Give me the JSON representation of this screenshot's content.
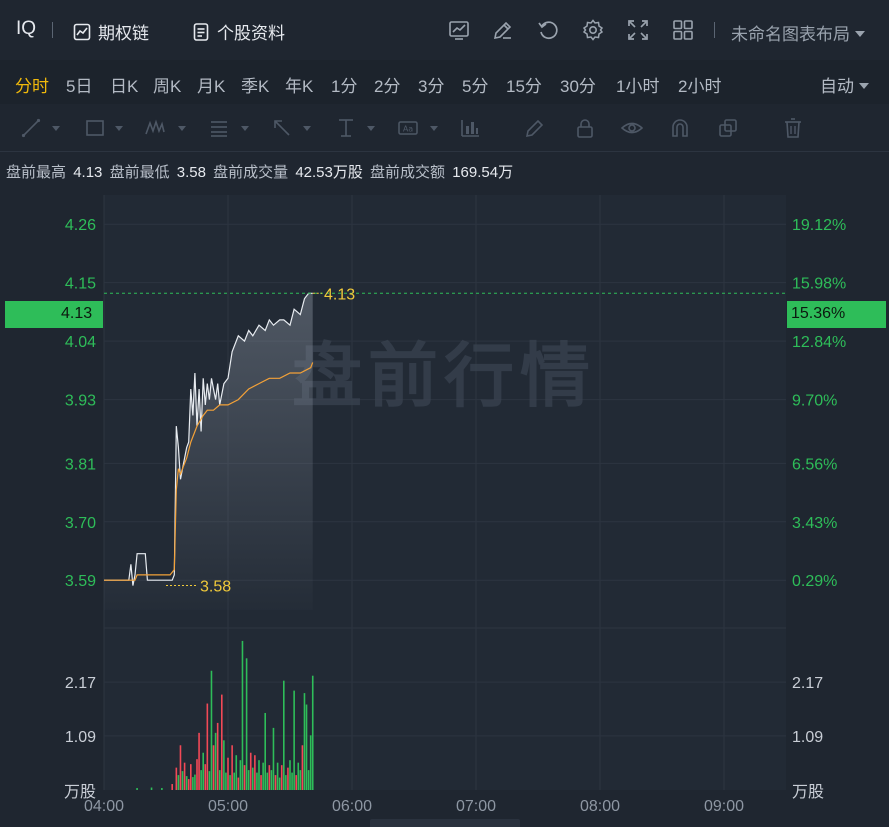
{
  "header": {
    "symbol": "IQ",
    "options_chain": "期权链",
    "stock_profile": "个股资料",
    "layout": "未命名图表布局"
  },
  "periods": [
    "分时",
    "5日",
    "日K",
    "周K",
    "月K",
    "季K",
    "年K",
    "1分",
    "2分",
    "3分",
    "5分",
    "15分",
    "30分",
    "1小时",
    "2小时"
  ],
  "active_period": "分时",
  "auto_label": "自动",
  "info": {
    "high_label": "盘前最高",
    "high": "4.13",
    "low_label": "盘前最低",
    "low": "3.58",
    "vol_label": "盘前成交量",
    "vol": "42.53万股",
    "amt_label": "盘前成交额",
    "amt": "169.54万"
  },
  "colors": {
    "up": "#2ebd59",
    "down": "#f24957",
    "avg_line": "#f3a138",
    "price_line": "#e8ecf1",
    "highlight": "#f0c93a",
    "grid": "#2d3541"
  },
  "chart_data": {
    "type": "line",
    "watermark": "盘前行情",
    "x_ticks": [
      "04:00",
      "05:00",
      "06:00",
      "07:00",
      "08:00",
      "09:00"
    ],
    "x_range_minutes": [
      240,
      570
    ],
    "price_ticks": [
      "4.26",
      "4.04",
      "3.93",
      "3.81",
      "3.70",
      "3.59"
    ],
    "price_range": [
      3.534,
      4.315
    ],
    "pct_ticks": [
      "19.12%",
      "12.84%",
      "9.70%",
      "6.56%",
      "3.43%",
      "0.29%"
    ],
    "hidden_tick_left": "4.15",
    "hidden_tick_right": "15.98%",
    "current_price": "4.13",
    "current_pct": "15.36%",
    "high_marker": "4.13",
    "low_marker": "3.58",
    "high_value": 4.13,
    "low_value": 3.58,
    "vol_ticks": [
      "2.17",
      "1.09"
    ],
    "vol_unit": "万股",
    "vol_range": [
      0,
      3.26
    ],
    "price_series": {
      "name": "price",
      "x": [
        240,
        252,
        253,
        254,
        255,
        256,
        257,
        258,
        260,
        261,
        262,
        263,
        265,
        268,
        270,
        272,
        273,
        274,
        275,
        276,
        277,
        278,
        279,
        280,
        281,
        282,
        283,
        284,
        285,
        286,
        287,
        288,
        289,
        290,
        291,
        292,
        293,
        294,
        295,
        296,
        297,
        298,
        300,
        302,
        305,
        308,
        310,
        312,
        315,
        318,
        320,
        322,
        325,
        327,
        330,
        332,
        335,
        337,
        339,
        340,
        341
      ],
      "y": [
        3.59,
        3.59,
        3.62,
        3.58,
        3.6,
        3.64,
        3.64,
        3.64,
        3.64,
        3.59,
        3.59,
        3.59,
        3.59,
        3.59,
        3.59,
        3.59,
        3.59,
        3.6,
        3.88,
        3.84,
        3.78,
        3.8,
        3.82,
        3.84,
        3.85,
        3.95,
        3.9,
        3.98,
        3.88,
        3.95,
        3.87,
        3.97,
        3.92,
        3.96,
        3.93,
        3.97,
        3.95,
        3.93,
        3.96,
        3.92,
        3.94,
        3.96,
        3.97,
        4.02,
        4.05,
        4.04,
        4.06,
        4.05,
        4.07,
        4.06,
        4.08,
        4.07,
        4.08,
        4.08,
        4.07,
        4.1,
        4.09,
        4.12,
        4.13,
        4.13,
        4.13
      ]
    },
    "avg_series": {
      "name": "average",
      "x": [
        240,
        255,
        256,
        265,
        270,
        272,
        274,
        275,
        276,
        277,
        278,
        279,
        280,
        282,
        285,
        288,
        290,
        293,
        296,
        300,
        305,
        310,
        315,
        320,
        325,
        330,
        335,
        340,
        341
      ],
      "y": [
        3.59,
        3.59,
        3.6,
        3.6,
        3.6,
        3.6,
        3.61,
        3.76,
        3.8,
        3.79,
        3.8,
        3.81,
        3.82,
        3.85,
        3.88,
        3.9,
        3.91,
        3.91,
        3.92,
        3.92,
        3.93,
        3.95,
        3.96,
        3.97,
        3.97,
        3.98,
        3.98,
        3.99,
        4.0
      ]
    },
    "volume_series": {
      "name": "volume",
      "x": [
        256,
        263,
        268,
        273,
        275,
        276,
        277,
        278,
        279,
        280,
        281,
        282,
        283,
        284,
        285,
        286,
        287,
        288,
        289,
        290,
        291,
        292,
        293,
        294,
        295,
        296,
        297,
        298,
        299,
        300,
        301,
        302,
        303,
        304,
        305,
        306,
        307,
        308,
        309,
        310,
        311,
        312,
        313,
        314,
        315,
        316,
        317,
        318,
        319,
        320,
        321,
        322,
        323,
        324,
        325,
        326,
        327,
        328,
        329,
        330,
        331,
        332,
        333,
        334,
        335,
        336,
        337,
        338,
        339,
        340,
        341
      ],
      "y": [
        0.04,
        0.05,
        0.04,
        0.12,
        0.45,
        0.3,
        0.9,
        0.38,
        0.55,
        0.28,
        0.22,
        0.52,
        0.26,
        0.31,
        0.62,
        1.15,
        0.4,
        0.75,
        0.52,
        1.74,
        0.38,
        2.4,
        0.9,
        1.15,
        1.35,
        0.4,
        1.92,
        1.0,
        0.35,
        0.65,
        0.3,
        0.9,
        0.35,
        0.7,
        0.25,
        0.6,
        3.0,
        0.5,
        2.65,
        0.4,
        0.75,
        0.45,
        0.7,
        0.35,
        0.6,
        0.3,
        0.55,
        1.55,
        0.35,
        0.5,
        0.4,
        1.25,
        0.3,
        0.55,
        0.25,
        0.5,
        2.2,
        0.3,
        0.45,
        0.6,
        0.35,
        2.0,
        0.3,
        0.55,
        0.4,
        0.9,
        1.95,
        1.72,
        0.4,
        1.1,
        2.3
      ],
      "color": [
        "up",
        "up",
        "up",
        "down",
        "down",
        "up",
        "down",
        "up",
        "down",
        "up",
        "down",
        "down",
        "up",
        "up",
        "down",
        "down",
        "up",
        "up",
        "down",
        "down",
        "up",
        "up",
        "down",
        "up",
        "down",
        "up",
        "down",
        "up",
        "up",
        "down",
        "up",
        "down",
        "up",
        "up",
        "down",
        "up",
        "up",
        "down",
        "up",
        "up",
        "down",
        "up",
        "down",
        "up",
        "up",
        "down",
        "up",
        "up",
        "up",
        "down",
        "up",
        "up",
        "down",
        "up",
        "up",
        "down",
        "up",
        "up",
        "down",
        "up",
        "up",
        "up",
        "down",
        "up",
        "up",
        "down",
        "up",
        "up",
        "up",
        "up",
        "up"
      ]
    }
  }
}
